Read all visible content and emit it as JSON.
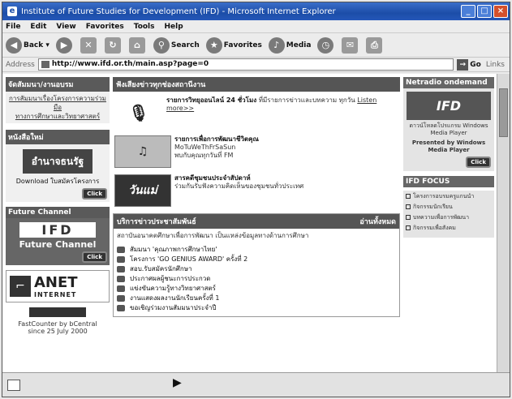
{
  "window": {
    "title": "Institute of Future Studies for Development (IFD) - Microsoft Internet Explorer",
    "buttons": {
      "min": "_",
      "max": "□",
      "close": "×"
    }
  },
  "menu": [
    "File",
    "Edit",
    "View",
    "Favorites",
    "Tools",
    "Help"
  ],
  "toolbar": {
    "back": "Back",
    "search": "Search",
    "favorites": "Favorites",
    "media": "Media"
  },
  "address": {
    "label": "Address",
    "url": "http://www.ifd.or.th/main.asp?page=0",
    "go": "Go",
    "links": "Links"
  },
  "left": {
    "section1_head": "จัดสัมมนา/งานอบรม",
    "section1_links": [
      "การสัมมนาเรื่องโครงการความร่วมมือ",
      "ทางการศึกษาและวิทยาศาสตร์"
    ],
    "section2_head": "หนังสือใหม่",
    "book_banner": "อำนาจธนรัฐ",
    "download": "Download ใบสมัครโครงการ",
    "click": "Click",
    "future_channel_head": "Future Channel",
    "ifd_logo": "IFD",
    "future_channel": "Future Channel",
    "anet": "ANET",
    "anet_sub": "INTERNET",
    "counter": "FastCounter by bCentral",
    "since": "since 25 July 2000"
  },
  "middle": {
    "head": "ฟังเสียงข่าวทุกช่องสถานีงาน",
    "radio1_title": "รายการวิทยุออนไลน์ 24 ชั่วโมง",
    "radio1_text": "ที่มีรายการข่าวและบทความ ทุกวัน",
    "radio1_link": "Listen more>>",
    "radio2_title": "รายการเพื่อการพัฒนาชีวิตคุณ",
    "radio2_days": "MoTuWeThFrSaSun",
    "radio2_text": "พบกับคุณทุกวันที่ FM",
    "radio3_title": "สารคดีชุมชนประจำสัปดาห์",
    "radio3_text": "ร่วมกันรับฟังความคิดเห็นของชุมชนทั่วประเทศ",
    "news_head": "บริการข่าวประชาสัมพันธ์",
    "news_right": "อ่านทั้งหมด",
    "news_intro": "สถาบันอนาคตศึกษาเพื่อการพัฒนา เป็นแหล่งข้อมูลทางด้านการศึกษา",
    "news_items": [
      "สัมมนา 'คุณภาพการศึกษาไทย'",
      "โครงการ 'GO GENIUS AWARD' ครั้งที่ 2",
      "สอบ.รับสมัครนักศึกษา",
      "ประกาศผลผู้ชนะการประกวด",
      "แข่งขันความรู้ทางวิทยาศาสตร์",
      "งานแสดงผลงานนักเรียนครั้งที่ 1",
      "ขอเชิญร่วมงานสัมมนาประจำปี"
    ]
  },
  "right": {
    "netradio_head": "Netradio ondemand",
    "ifd_logo": "IFD",
    "install_text": "ดาวน์โหลดโปรแกรม Windows Media Player",
    "presented": "Presented by Windows Media Player",
    "click": "Click",
    "focus_head": "IFD FOCUS",
    "focus_items": [
      "โครงการอบรมครูแกนนำ",
      "กิจกรรมนักเรียน",
      "บทความเพื่อการพัฒนา",
      "กิจกรรมเพื่อสังคม"
    ]
  }
}
